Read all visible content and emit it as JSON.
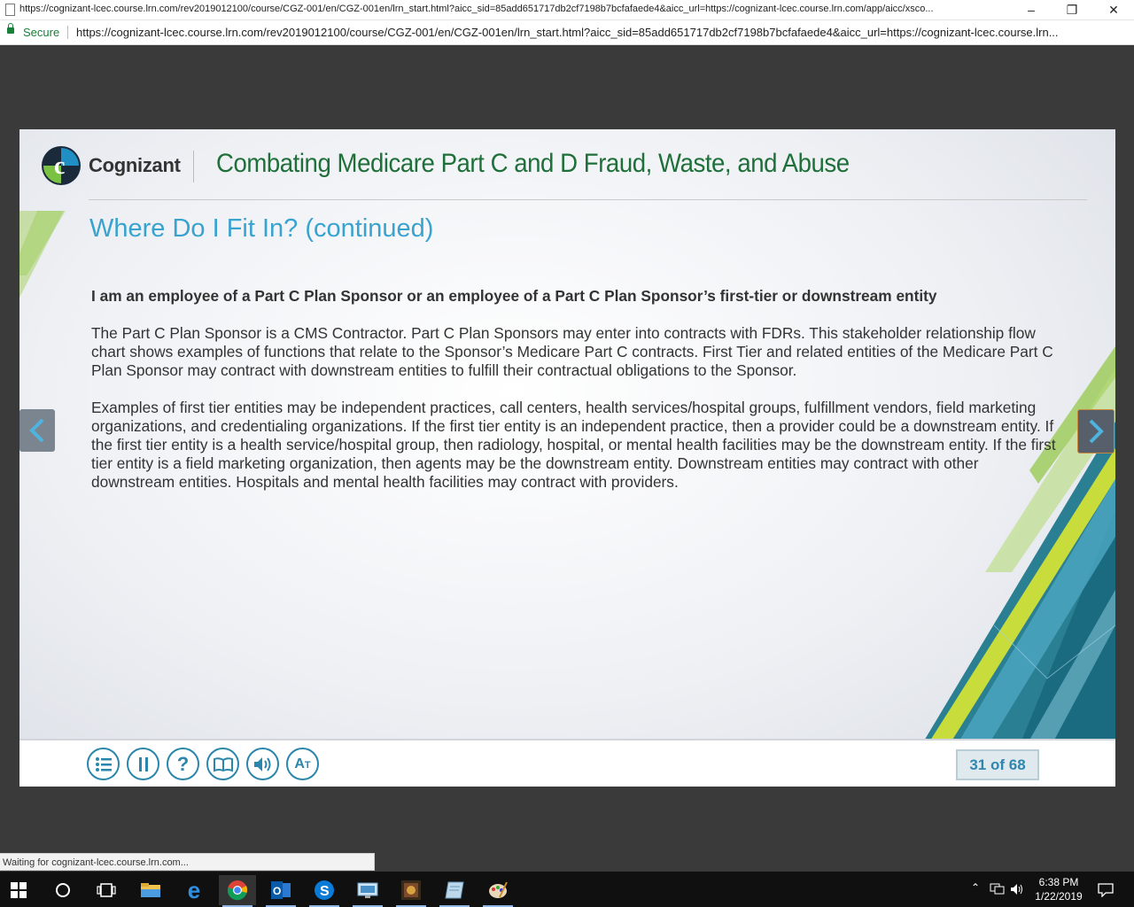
{
  "browser": {
    "window_title": "https://cognizant-lcec.course.lrn.com/rev2019012100/course/CGZ-001/en/CGZ-001en/lrn_start.html?aicc_sid=85add651717db2cf7198b7bcfafaede4&aicc_url=https://cognizant-lcec.course.lrn.com/app/aicc/xsco...",
    "secure_label": "Secure",
    "url": "https://cognizant-lcec.course.lrn.com/rev2019012100/course/CGZ-001/en/CGZ-001en/lrn_start.html?aicc_sid=85add651717db2cf7198b7bcfafaede4&aicc_url=https://cognizant-lcec.course.lrn...",
    "status_text": "Waiting for cognizant-lcec.course.lrn.com..."
  },
  "course": {
    "brand_name": "Cognizant",
    "title": "Combating Medicare Part C and D Fraud, Waste, and Abuse",
    "slide_heading": "Where Do I Fit In? (continued)",
    "lead": "I am an employee of a Part C Plan Sponsor or an employee of a Part C Plan Sponsor’s first-tier or downstream entity",
    "paragraph1": "The Part C Plan Sponsor is a CMS Contractor. Part C Plan Sponsors may enter into contracts with FDRs. This stakeholder relationship flow chart shows examples of functions that relate to the Sponsor’s Medicare Part C contracts. First Tier and related entities of the Medicare Part C Plan Sponsor may contract with downstream entities to fulfill their contractual obligations to the Sponsor.",
    "paragraph2": "Examples of first tier entities may be independent practices, call centers, health services/hospital groups, fulfillment vendors, field marketing organizations, and credentialing organizations. If the first tier entity is an independent practice, then a provider could be a downstream entity. If the first tier entity is a health service/hospital group, then radiology, hospital, or mental health facilities may be the downstream entity. If the first tier entity is a field marketing organization, then agents may be the downstream entity. Downstream entities may contract with other downstream entities. Hospitals and mental health facilities may contract with providers.",
    "page_counter": "31 of 68",
    "controls": [
      "menu-icon",
      "pause-icon",
      "help-icon",
      "glossary-icon",
      "audio-icon",
      "text-size-icon"
    ]
  },
  "taskbar": {
    "time": "6:38 PM",
    "date": "1/22/2019"
  },
  "colors": {
    "heading_blue": "#39a3cf",
    "title_green": "#1f6f3a",
    "control_blue": "#2b86ab",
    "secure_green": "#188038"
  }
}
